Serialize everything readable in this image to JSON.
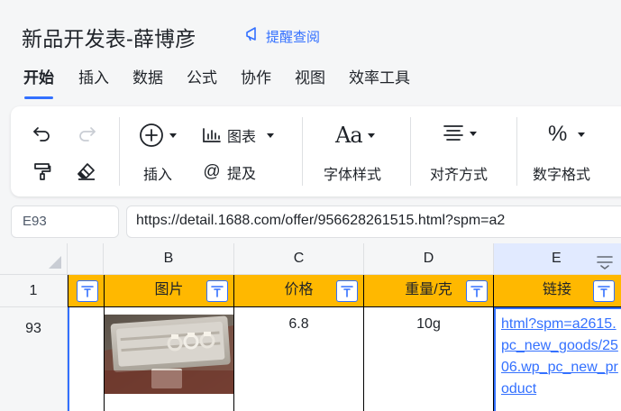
{
  "document": {
    "title": "新品开发表-薛博彦",
    "remind_label": "提醒查阅"
  },
  "tabs": [
    {
      "label": "开始",
      "active": true
    },
    {
      "label": "插入"
    },
    {
      "label": "数据"
    },
    {
      "label": "公式"
    },
    {
      "label": "协作"
    },
    {
      "label": "视图"
    },
    {
      "label": "效率工具"
    }
  ],
  "toolbar": {
    "insert_label": "插入",
    "chart_label": "图表",
    "mention_label": "提及",
    "font_style_label": "字体样式",
    "align_label": "对齐方式",
    "number_format_label": "数字格式",
    "font_icon_text": "Aa",
    "percent_icon_text": "%",
    "mention_icon_text": "@"
  },
  "formula_bar": {
    "cell_ref": "E93",
    "value": "https://detail.1688.com/offer/956628261515.html?spm=a2"
  },
  "grid": {
    "columns": [
      "B",
      "C",
      "D",
      "E"
    ],
    "header_row_number": "1",
    "data_row_number": "93",
    "header_cells": {
      "b": "图片",
      "c": "价格",
      "d": "重量/克",
      "e": "链接"
    },
    "data_cells": {
      "c": "6.8",
      "d": "10g",
      "e": "html?spm=a2615.pc_new_goods/2506.wp_pc_new_product"
    }
  },
  "colors": {
    "accent": "#3370ff",
    "header_fill": "#ffb800"
  }
}
